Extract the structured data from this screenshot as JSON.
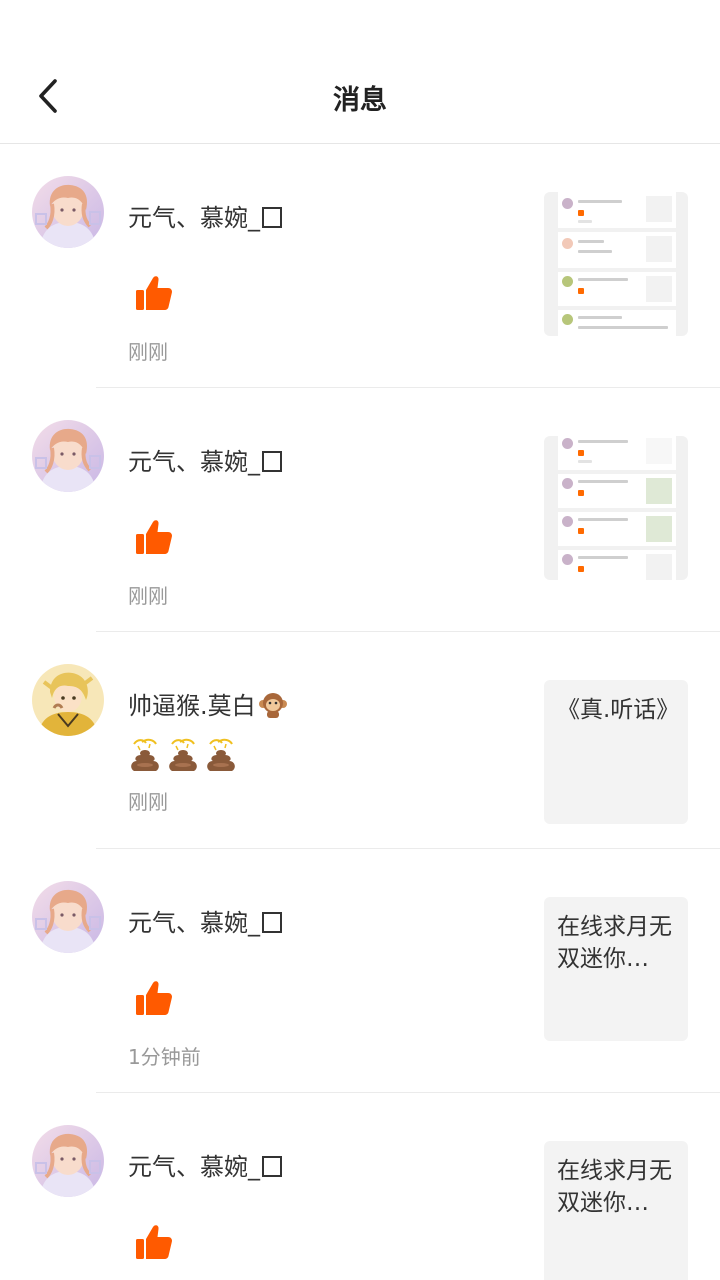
{
  "header": {
    "title": "消息"
  },
  "colors": {
    "like": "#FF5A00",
    "time": "#999999",
    "thumb_bg": "#F3F3F3",
    "divider": "#EBEBEB"
  },
  "messages": [
    {
      "name": "元气、慕婉_",
      "reaction": "like-icon",
      "time": "刚刚",
      "preview": "screenshot"
    },
    {
      "name": "元气、慕婉_",
      "reaction": "like-icon",
      "time": "刚刚",
      "preview": "screenshot"
    },
    {
      "name": "帅逼猴.莫白",
      "name_icon": "monkey-icon",
      "reaction": "poo-icon x3",
      "time": "刚刚",
      "preview_text": "《真.听话》"
    },
    {
      "name": "元气、慕婉_",
      "reaction": "like-icon",
      "time": "1分钟前",
      "preview_text": "在线求月无双迷你…"
    },
    {
      "name": "元气、慕婉_",
      "reaction": "like-icon",
      "time": "",
      "preview_text": "在线求月无双迷你…"
    }
  ]
}
